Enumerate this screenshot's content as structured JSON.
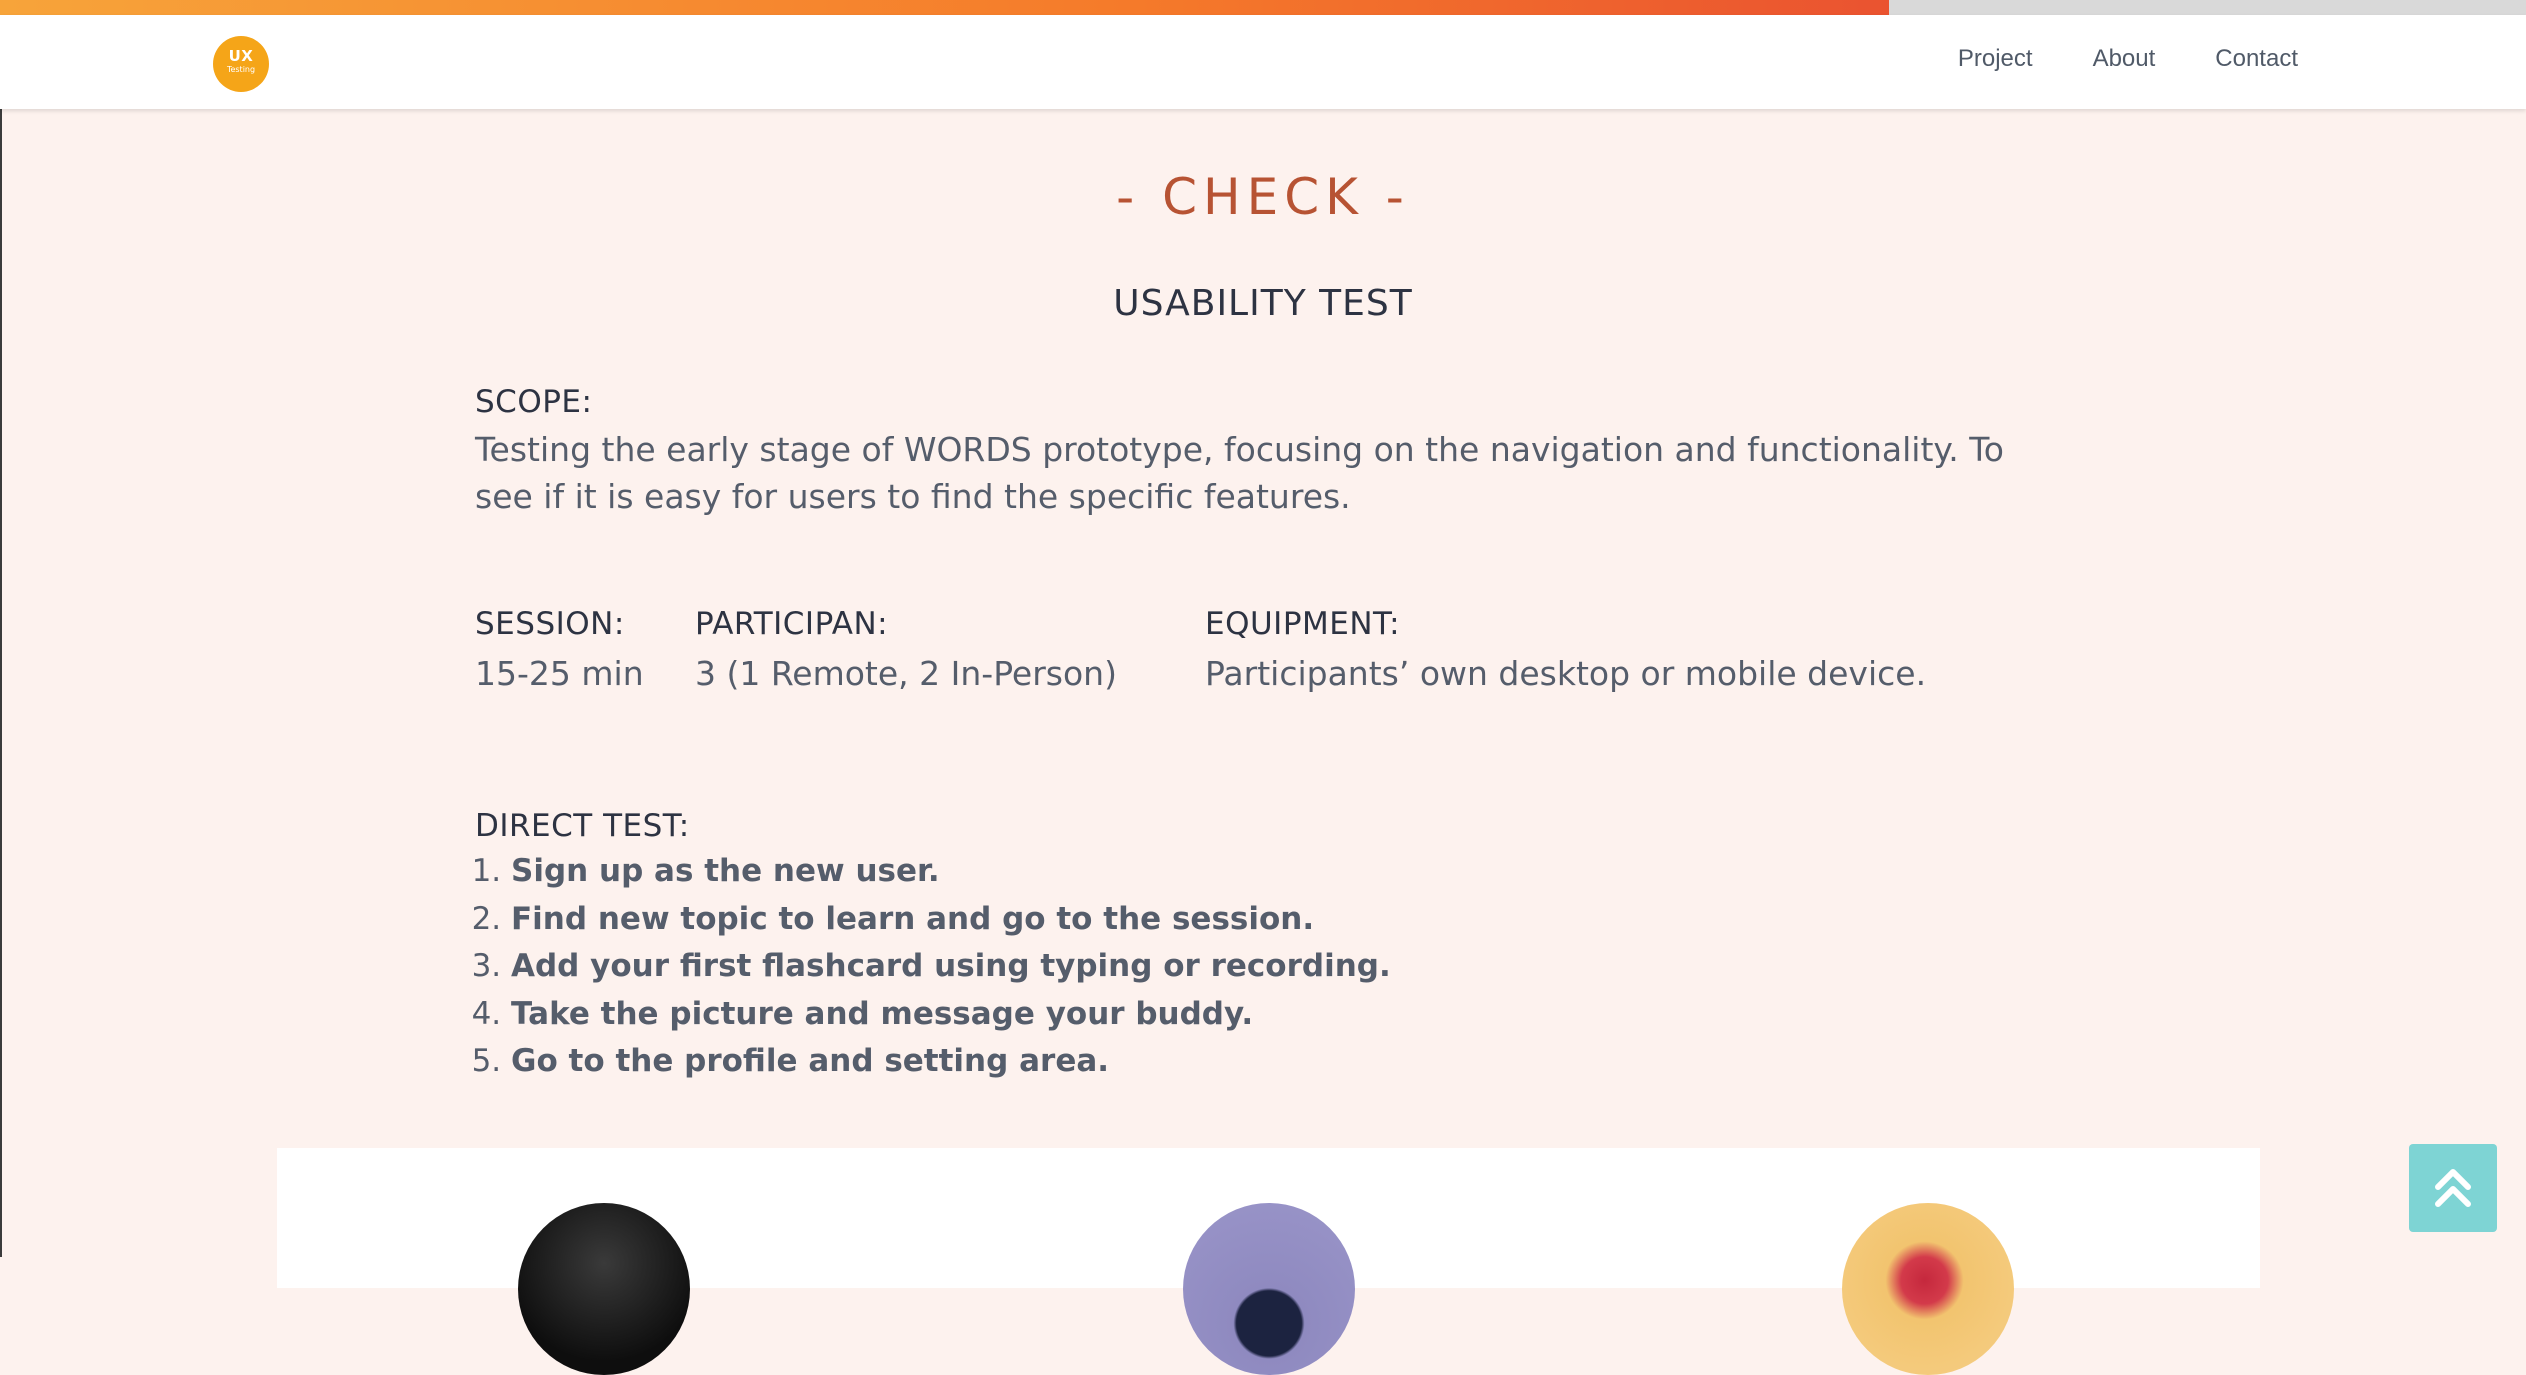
{
  "progress": {
    "fraction": 0.748
  },
  "header": {
    "logo": {
      "main": "UX",
      "sub": "Testing"
    },
    "nav": [
      {
        "label": "Project"
      },
      {
        "label": "About"
      },
      {
        "label": "Contact"
      }
    ]
  },
  "main": {
    "section_title": "- CHECK -",
    "subtitle": "USABILITY TEST",
    "scope": {
      "label": "SCOPE:",
      "text": "Testing the early stage of WORDS prototype, focusing on the navigation and functionality. To see if it is easy for users to find the specific features."
    },
    "session": {
      "label": "SESSION:",
      "value": "15-25 min"
    },
    "participants": {
      "label": "PARTICIPAN:",
      "value": "3 (1 Remote, 2 In-Person)"
    },
    "equipment": {
      "label": "EQUIPMENT:",
      "value": "Participants’ own desktop or mobile device."
    },
    "direct_test": {
      "label": "DIRECT TEST:",
      "steps": [
        "Sign up as the new user.",
        "Find new topic to learn and go to the session.",
        "Add your first flashcard using typing or recording.",
        "Take the picture and message your buddy.",
        "Go to the profile and setting area."
      ]
    }
  },
  "icons": {
    "scroll_top": "double-chevron-up-icon"
  },
  "colors": {
    "page_background": "#fdf2ee",
    "accent_title": "#b75333",
    "logo": "#f5a518",
    "scroll_button": "#7ed4d4"
  }
}
